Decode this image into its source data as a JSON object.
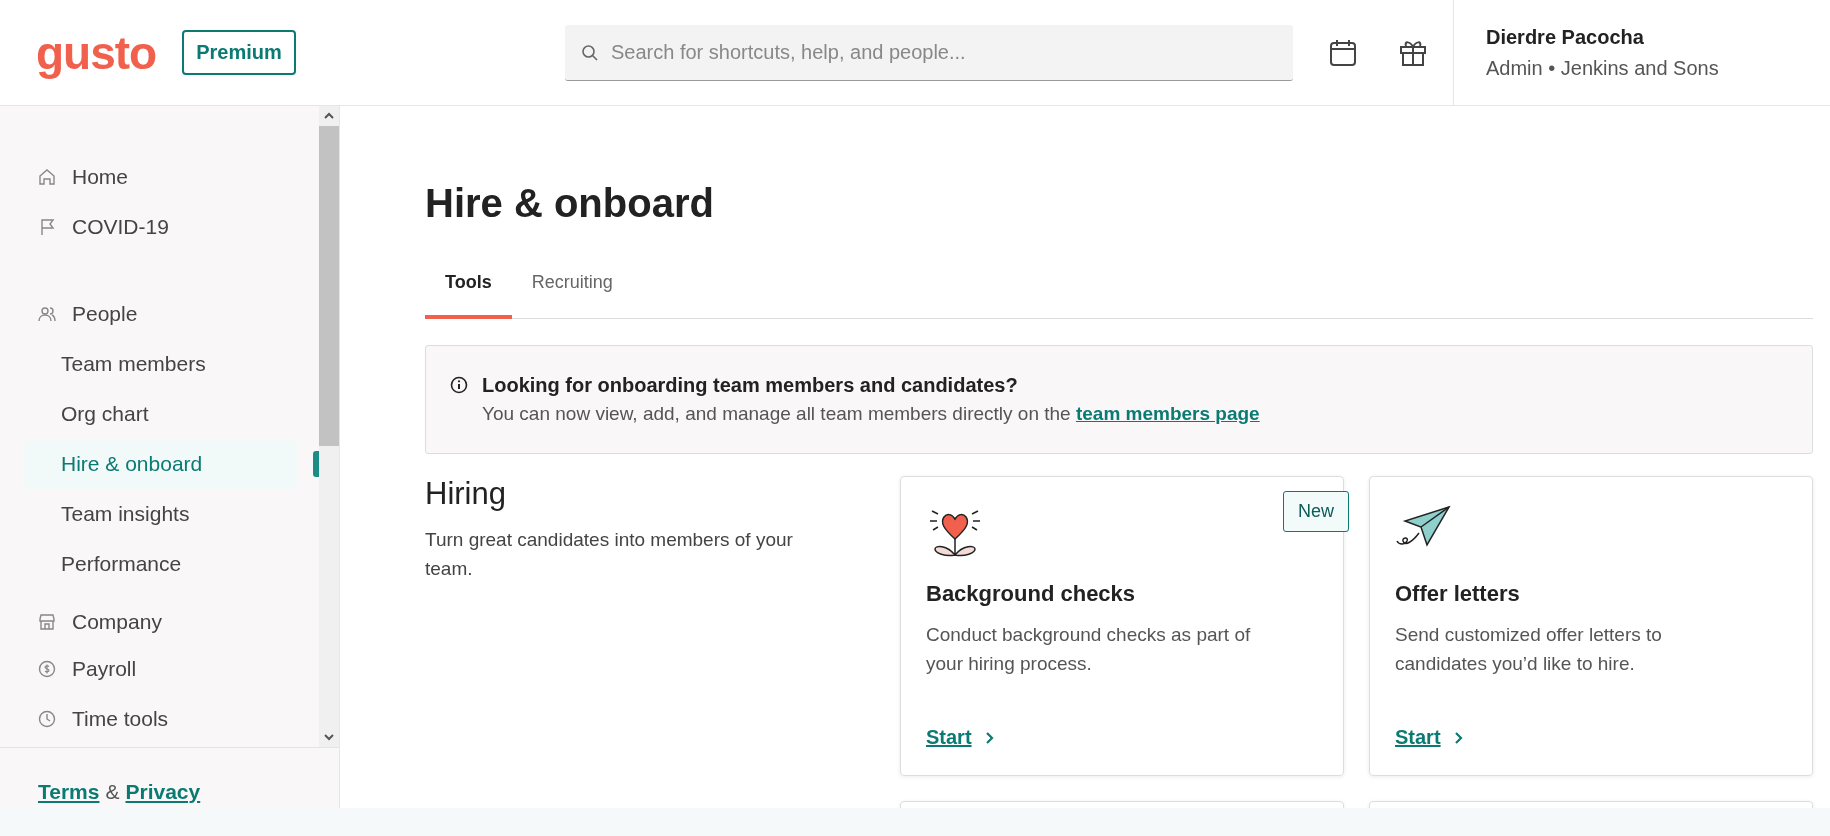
{
  "header": {
    "logo": "gusto",
    "plan_badge": "Premium",
    "search": {
      "placeholder": "Search for shortcuts, help, and people..."
    },
    "user": {
      "name": "Dierdre Pacocha",
      "subtitle": "Admin • Jenkins and Sons"
    }
  },
  "sidebar": {
    "items": [
      {
        "label": "Home",
        "selected": false
      },
      {
        "label": "COVID-19",
        "selected": false
      },
      {
        "label": "People",
        "selected": false,
        "children": [
          {
            "label": "Team members",
            "selected": false
          },
          {
            "label": "Org chart",
            "selected": false
          },
          {
            "label": "Hire & onboard",
            "selected": true
          },
          {
            "label": "Team insights",
            "selected": false
          },
          {
            "label": "Performance",
            "selected": false
          }
        ]
      },
      {
        "label": "Company",
        "selected": false
      },
      {
        "label": "Payroll",
        "selected": false
      },
      {
        "label": "Time tools",
        "selected": false
      }
    ],
    "footer": {
      "terms": "Terms",
      "separator": "&",
      "privacy": "Privacy"
    }
  },
  "page": {
    "title": "Hire & onboard",
    "tabs": [
      {
        "label": "Tools",
        "selected": true
      },
      {
        "label": "Recruiting",
        "selected": false
      }
    ],
    "notice": {
      "title": "Looking for onboarding team members and candidates?",
      "text": "You can now view, add, and manage all team members directly on the",
      "link": "team members page"
    },
    "section": {
      "title": "Hiring",
      "description": "Turn great candidates into members of your team."
    },
    "cards": [
      {
        "title": "Background checks",
        "description": "Conduct background checks as part of your hiring process.",
        "badge": "New",
        "action": "Start"
      },
      {
        "title": "Offer letters",
        "description": "Send customized offer letters to candidates you’d like to hire.",
        "action": "Start"
      }
    ]
  }
}
